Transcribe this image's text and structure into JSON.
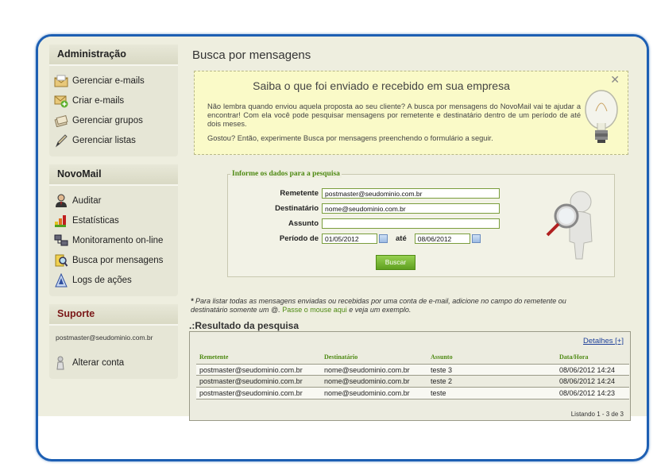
{
  "sidebar": {
    "admin": {
      "title": "Administração",
      "items": [
        {
          "label": "Gerenciar e-mails",
          "icon": "envelope-icon"
        },
        {
          "label": "Criar e-mails",
          "icon": "new-email-icon"
        },
        {
          "label": "Gerenciar grupos",
          "icon": "group-icon"
        },
        {
          "label": "Gerenciar listas",
          "icon": "pencil-icon"
        }
      ]
    },
    "novomail": {
      "title": "NovoMail",
      "items": [
        {
          "label": "Auditar",
          "icon": "auditor-icon"
        },
        {
          "label": "Estatísticas",
          "icon": "bar-chart-icon"
        },
        {
          "label": "Monitoramento on-line",
          "icon": "network-icon"
        },
        {
          "label": "Busca por mensagens",
          "icon": "search-messages-icon"
        },
        {
          "label": "Logs de ações",
          "icon": "logs-icon"
        }
      ]
    },
    "support": {
      "title": "Suporte",
      "email": "postmaster@seudominio.com.br",
      "change_account": "Alterar conta"
    }
  },
  "main": {
    "title": "Busca por mensagens",
    "info": {
      "title": "Saiba o que foi enviado e recebido em sua empresa",
      "text": "Não lembra quando enviou aquela proposta ao seu cliente? A busca por mensagens do NovoMail vai te ajudar a encontrar! Com ela você pode pesquisar mensagens por remetente e destinatário dentro de um período de até dois meses.",
      "text2": "Gostou? Então, experimente Busca por mensagens preenchendo o formulário a seguir.",
      "close": "✕"
    },
    "form": {
      "legend": "Informe os dados para a pesquisa",
      "remetente_label": "Remetente",
      "remetente_value": "postmaster@seudominio.com.br",
      "destinatario_label": "Destinatário",
      "destinatario_value": "nome@seudominio.com.br",
      "assunto_label": "Assunto",
      "assunto_value": "",
      "periodo_label": "Período de",
      "date_from": "01/05/2012",
      "ate_label": "até",
      "date_to": "08/06/2012",
      "button": "Buscar"
    },
    "note": {
      "star": "*",
      "part1": "Para listar todas as mensagens enviadas ou recebidas por uma conta de e-mail, adicione no campo do remetente ou destinatário somente um @.",
      "link": "Passe o mouse aqui",
      "part2": "e veja um exemplo."
    },
    "results": {
      "title": ".:Resultado da pesquisa",
      "details": "Detalhes [+]",
      "columns": [
        "Remetente",
        "Destinatário",
        "Assunto",
        "Data/Hora"
      ],
      "rows": [
        [
          "postmaster@seudominio.com.br",
          "nome@seudominio.com.br",
          "teste 3",
          "08/06/2012 14:24"
        ],
        [
          "postmaster@seudominio.com.br",
          "nome@seudominio.com.br",
          "teste 2",
          "08/06/2012 14:24"
        ],
        [
          "postmaster@seudominio.com.br",
          "nome@seudominio.com.br",
          "teste",
          "08/06/2012 14:23"
        ]
      ],
      "listing": "Listando 1 - 3 de 3"
    }
  },
  "colors": {
    "frame_border": "#1d5fb3",
    "accent_green": "#4f8a14",
    "info_bg": "#fafac8",
    "content_bg": "#eeeedf"
  }
}
